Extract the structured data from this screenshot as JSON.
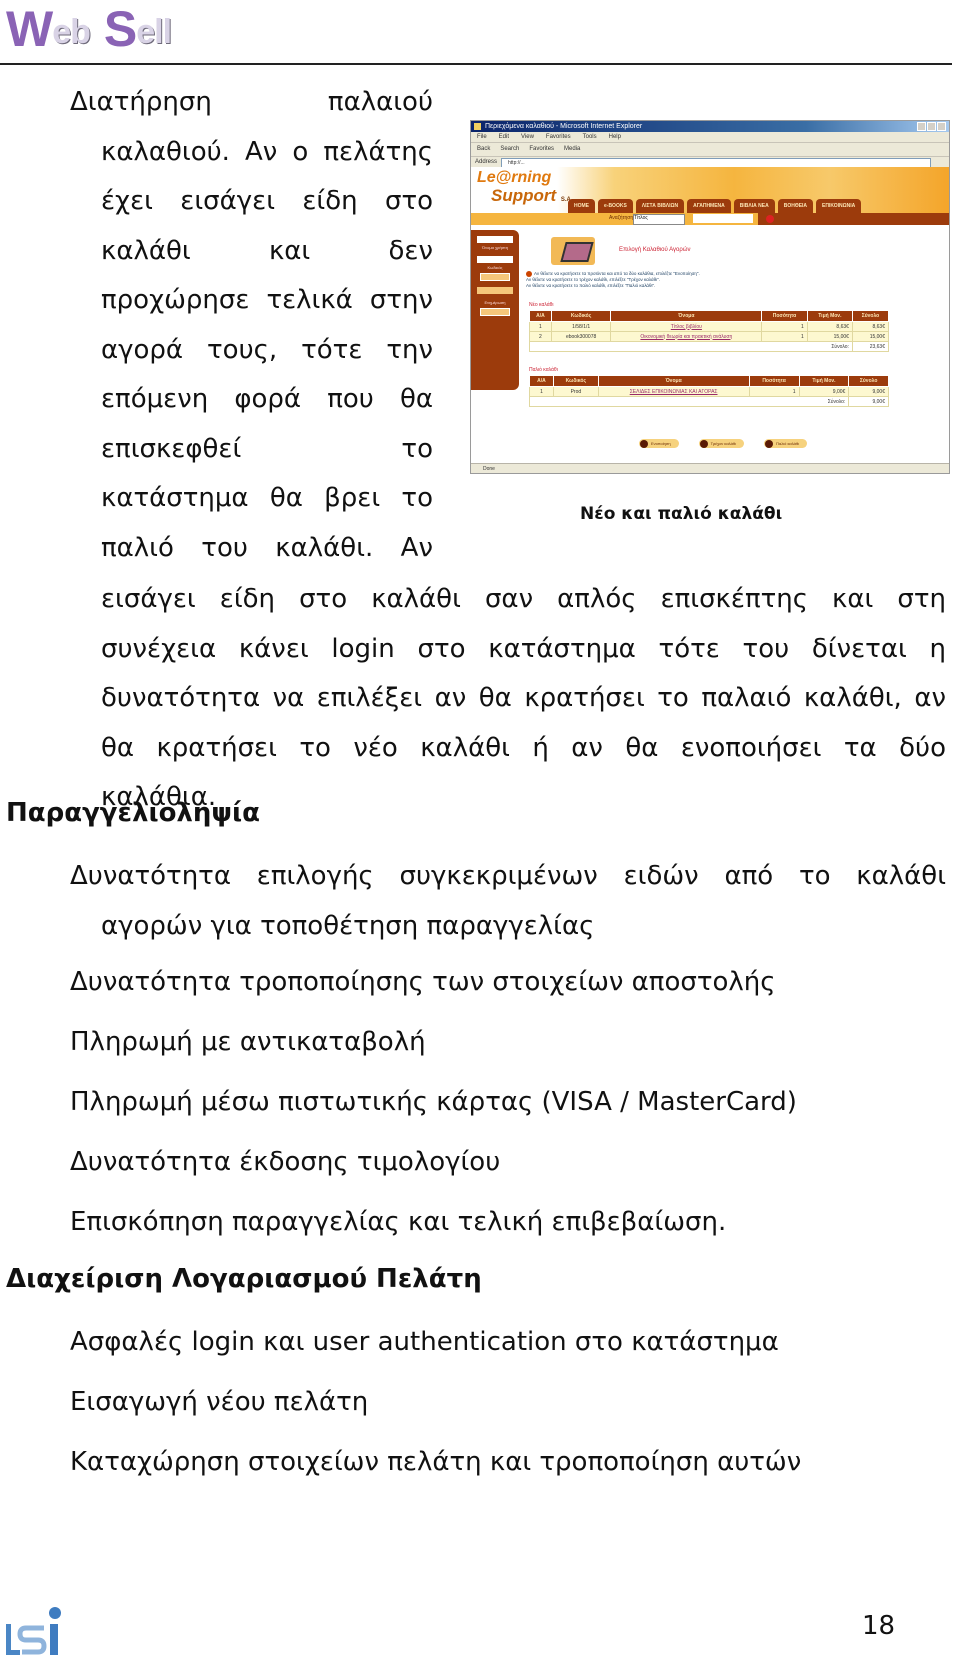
{
  "header": {
    "logo_part1_big": "W",
    "logo_part1_small": "eb",
    "logo_part2_big": "S",
    "logo_part2_small": "ell",
    "logo_color": "#8a63b5"
  },
  "section_cart": {
    "narrow_paragraph_lines": [
      "Διατήρηση παλαιού",
      "καλαθιού. Αν ο πελάτης",
      "έχει εισάγει είδη στο",
      "καλάθι και δεν",
      "προχώρησε τελικά στην",
      "αγορά τους, τότε την",
      "επόμενη φορά που θα",
      "επισκεφθεί το",
      "κατάστημα θα βρει το",
      "παλιό του καλάθι. Αν"
    ],
    "wide_paragraph_lines": [
      "εισάγει είδη στο καλάθι σαν απλός επισκέπτης και στη",
      "συνέχεια κάνει login στο κατάστημα τότε του δίνεται η",
      "δυνατότητα να επιλέξει αν θα κρατήσει το παλαιό καλάθι, αν",
      "θα κρατήσει το νέο καλάθι ή αν θα ενοποιήσει τα δύο",
      "καλάθια."
    ]
  },
  "figure": {
    "caption": "Νέο και παλιό καλάθι",
    "browser": {
      "window_title": "Περιεχόμενα καλαθιού - Microsoft Internet Explorer",
      "menu": [
        "File",
        "Edit",
        "View",
        "Favorites",
        "Tools",
        "Help"
      ],
      "toolbar": [
        "Back",
        "Search",
        "Favorites",
        "Media"
      ],
      "address_label": "Address",
      "address_value": "http://...",
      "status": "Done"
    },
    "site": {
      "logo_line1": "Le@rning",
      "logo_line2": "Support",
      "logo_suffix": "S.A.",
      "nav": [
        "HOME",
        "e-BOOKS",
        "ΛΙΣΤΑ ΒΙΒΛΙΩΝ",
        "ΑΓΑΠΗΜΕΝΑ",
        "ΒΙΒΛΙΑ ΝΕΑ",
        "ΒΟΗΘΕΙΑ",
        "ΕΠΙΚΟΙΝΩΝΙΑ"
      ],
      "search_label": "Αναζήτηση:",
      "search_select": "Τίτλος",
      "sidebar_labels": [
        "Όνομα χρήστη",
        "Κωδικός",
        "Είσοδος",
        "Νέος χρήστης",
        "Ενημέρωση"
      ],
      "page_title": "Επιλογή Καλαθιού Αγορών",
      "info_lines": [
        "Αν θέλετε να κρατήσετε τα προϊόντα και από τα δύο καλάθια, επιλέξτε \"Ενοποίηση\".",
        "Αν θέλετε να κρατήσετε το τρέχον καλάθι, επιλέξτε \"Τρέχον καλάθι\".",
        "Αν θέλετε να κρατήσετε το παλιό καλάθι, επιλέξτε \"Παλιό καλάθι\"."
      ],
      "new_cart": {
        "label": "Νέο καλάθι",
        "columns": [
          "Α/Α",
          "Κωδικός",
          "Όνομα",
          "Ποσότητα",
          "Τιμή Μον.",
          "Σύνολο"
        ],
        "rows": [
          [
            "1",
            "1/58/1/1",
            "Τίτλος βιβλίου",
            "1",
            "8,63€",
            "8,63€"
          ],
          [
            "2",
            "ebook300078",
            "Οικονομική θεωρία και πρακτική ανάλυση",
            "1",
            "15,00€",
            "15,00€"
          ]
        ],
        "total_label": "Σύνολο:",
        "total_value": "23,63€"
      },
      "old_cart": {
        "label": "Παλιό καλάθι",
        "columns": [
          "Α/Α",
          "Κωδικός",
          "Όνομα",
          "Ποσότητα",
          "Τιμή Μον.",
          "Σύνολο"
        ],
        "rows": [
          [
            "1",
            "Prod",
            "ΣΕΛΙΔΕΣ ΕΠΙΚΟΙΝΩΝΙΑΣ ΚΑΙ ΑΓΟΡΑΣ",
            "1",
            "9,00€",
            "9,00€"
          ]
        ],
        "total_label": "Σύνολο:",
        "total_value": "9,00€"
      },
      "actions": [
        "Ενοποίηση",
        "Τρέχον καλάθι",
        "Παλιό καλάθι"
      ]
    }
  },
  "section_orders": {
    "heading": "Παραγγελιοληψία",
    "items": [
      {
        "line1": "Δυνατότητα επιλογής συγκεκριμένων ειδών από το καλάθι",
        "line2": "αγορών για τοποθέτηση παραγγελίας"
      },
      {
        "line1": "Δυνατότητα τροποποίησης των στοιχείων αποστολής"
      },
      {
        "line1": "Πληρωμή με αντικαταβολή"
      },
      {
        "line1": "Πληρωμή μέσω πιστωτικής κάρτας (VISA / MasterCard)"
      },
      {
        "line1": "Δυνατότητα έκδοσης τιμολογίου"
      },
      {
        "line1": "Επισκόπηση παραγγελίας και τελική επιβεβαίωση."
      }
    ]
  },
  "section_account": {
    "heading": "Διαχείριση Λογαριασμού Πελάτη",
    "items": [
      {
        "line1": "Ασφαλές login και user authentication στο κατάστημα"
      },
      {
        "line1": "Εισαγωγή νέου πελάτη"
      },
      {
        "line1": "Καταχώρηση στοιχείων πελάτη και τροποποίηση αυτών"
      }
    ]
  },
  "footer": {
    "logo_text": "ISI",
    "page_number": "18"
  }
}
